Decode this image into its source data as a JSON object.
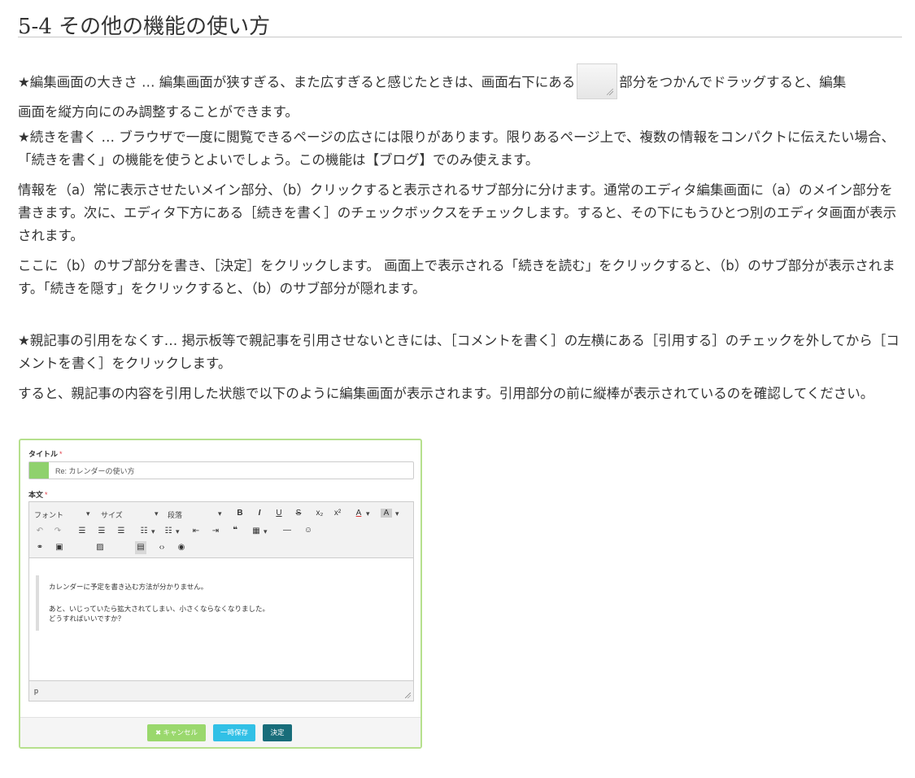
{
  "heading": "5-4 その他の機能の使い方",
  "paragraphs": {
    "p1a": "★編集画面の大きさ … 編集画面が狭すぎる、また広すぎると感じたときは、画面右下にある",
    "p1b": "部分をつかんでドラッグすると、編集",
    "p1c": "画面を縦方向にのみ調整することができます。",
    "p2": "★続きを書く … ブラウザで一度に閲覧できるページの広さには限りがあります。限りあるページ上で、複数の情報をコンパクトに伝えたい場合、「続きを書く」の機能を使うとよいでしょう。この機能は【ブログ】でのみ使えます。",
    "p3": "情報を（a）常に表示させたいメイン部分、（b）クリックすると表示されるサブ部分に分けます。通常のエディタ編集画面に（a）のメイン部分を書きます。次に、エディタ下方にある［続きを書く］のチェックボックスをチェックします。すると、その下にもうひとつ別のエディタ画面が表示されます。",
    "p4": "ここに（b）のサブ部分を書き、［決定］をクリックします。 画面上で表示される「続きを読む」をクリックすると、（b）のサブ部分が表示されます。「続きを隠す」をクリックすると、（b）のサブ部分が隠れます。",
    "p5": "★親記事の引用をなくす… 掲示板等で親記事を引用させないときには、［コメントを書く］の左横にある［引用する］のチェックを外してから［コメントを書く］をクリックします。",
    "p6": "すると、親記事の内容を引用した状態で以下のように編集画面が表示されます。引用部分の前に縦棒が表示されているのを確認してください。"
  },
  "figure": {
    "title_label": "タイトル",
    "required_mark": "*",
    "title_value": "Re: カレンダーの使い方",
    "body_label": "本文",
    "toolbar": {
      "font": "フォント",
      "size": "サイズ",
      "format": "段落",
      "dropdown_arrow": "▾",
      "bold": "B",
      "italic": "I",
      "underline": "U",
      "strike": "S",
      "sub": "x₂",
      "sup": "x²",
      "font_color": "A",
      "bg_color": "A"
    },
    "quote_lines": [
      "カレンダーに予定を書き込む方法が分かりません。",
      "あと、いじっていたら拡大されてしまい、小さくならなくなりました。",
      "どうすればいいですか？"
    ],
    "status_path": "p",
    "buttons": {
      "cancel": "✖ キャンセル",
      "temp_save": "一時保存",
      "ok": "決定"
    }
  }
}
